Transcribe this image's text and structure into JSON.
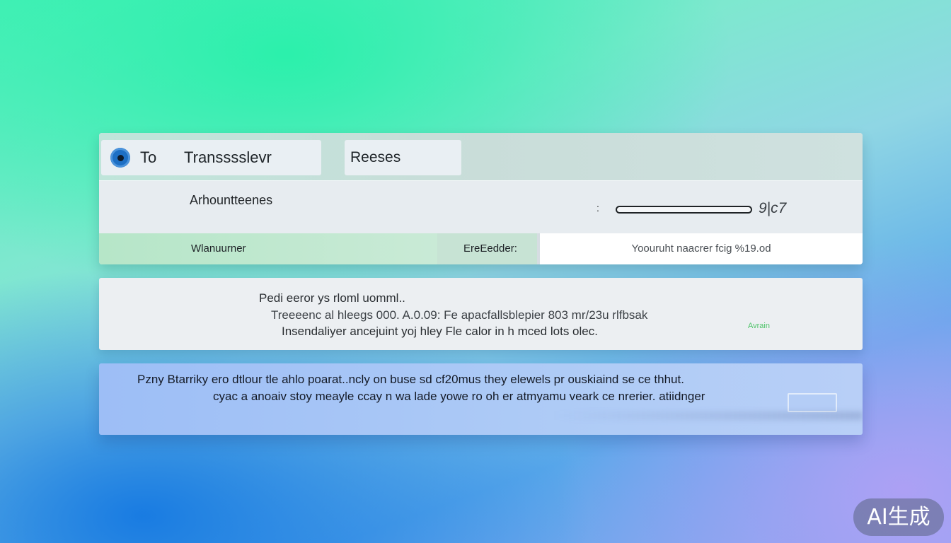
{
  "tabs": {
    "tab1_prefix": "To",
    "tab1_label": "Transssslevr",
    "tab2_label": "Reeses"
  },
  "amount": {
    "label": "Arhountteenes",
    "colon": ":",
    "value": "9|c7"
  },
  "fields": {
    "left_label": "Wlanuurner",
    "middle_label": "EreEedder:",
    "input_value": "Yoouruht naacrer fcig %19.od"
  },
  "middle_panel": {
    "line1": "Pedi eeror ys rloml uomml..",
    "line2": "Treeeenc al hleegs 000. A.0.09: Fe apacfallsblepier 803 mr/23u rlfbsak",
    "line3": "Insendaliyer ancejuint yoj hley Fle calor in h mced lots olec.",
    "tag": "Avrain"
  },
  "bottom_panel": {
    "line1": "Pzny   Btarriky ero dtlour tle ahlo poarat..ncly on buse sd cf20mus they elewels pr ouskiaind se ce thhut.",
    "line2": "cyac a anoaiv stoy meayle ccay n  wa lade yowe ro oh er atmyamu veark ce nrerier. atiidnger"
  },
  "watermark": "AI生成",
  "colors": {
    "accent": "#1d6fc4",
    "panel": "#e9eef2",
    "bottom_panel": "#a9c6f6",
    "tag_green": "#4fc46a"
  }
}
